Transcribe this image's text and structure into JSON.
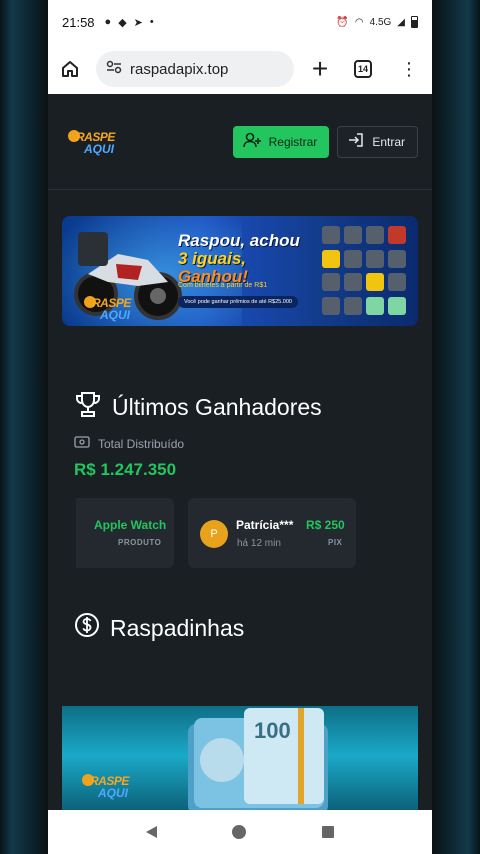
{
  "status_bar": {
    "time": "21:58",
    "network": "4.5G"
  },
  "browser": {
    "url": "raspadapix.top",
    "tab_count": "14"
  },
  "header": {
    "logo_line1": "RASPE",
    "logo_line2": "AQUI",
    "register_label": "Registrar",
    "login_label": "Entrar"
  },
  "promo_banner": {
    "title_part1": "Raspou, achou",
    "title_part2": "3 iguais,",
    "title_part3": "Ganhou!",
    "subtitle": "Com bilhetes a partir de R$1",
    "note": "Você pode ganhar prêmios de até R$25.000",
    "logo_line1": "RASPE",
    "logo_line2": "AQUI"
  },
  "winners": {
    "title": "Últimos Ganhadores",
    "total_label": "Total Distribuído",
    "total_value": "R$ 1.247.350",
    "cards": [
      {
        "prize": "Apple Watch",
        "type": "PRODUTO"
      },
      {
        "avatar": "P",
        "name": "Patrícia***",
        "time": "há 12 min",
        "prize": "R$ 250",
        "type": "PIX"
      }
    ]
  },
  "scratch_section": {
    "title": "Raspadinhas",
    "logo_line1": "RASPE",
    "logo_line2": "AQUI",
    "banknote": "100"
  },
  "colors": {
    "accent_green": "#22c55e",
    "page_bg": "#1a1f24",
    "card_bg": "#23292f"
  }
}
